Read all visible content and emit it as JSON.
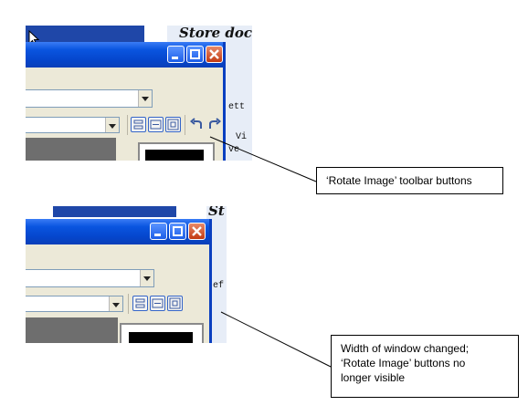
{
  "screenshot_before": {
    "doc_title": "Store doc",
    "code_lines": [
      "ett",
      "Vi",
      "ve"
    ],
    "window_buttons": [
      "minimize",
      "maximize",
      "close"
    ],
    "toolbar_icons": [
      "rotate-image-left-icon",
      "rotate-image-right-icon"
    ]
  },
  "screenshot_after": {
    "doc_title": "St",
    "code_lines": [
      "ef"
    ],
    "window_buttons": [
      "minimize",
      "maximize",
      "close"
    ]
  },
  "callouts": {
    "rotate_buttons": "‘Rotate Image’ toolbar buttons",
    "width_changed_lines": [
      "Width of window changed;",
      "‘Rotate Image’ buttons no",
      "longer visible"
    ]
  },
  "colors": {
    "titlebar": "#0a55e0",
    "window_face": "#ece9d8",
    "close_button": "#c23a12",
    "desktop": "#1f47a8"
  }
}
